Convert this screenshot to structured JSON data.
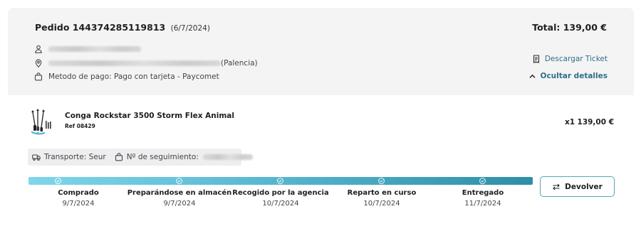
{
  "order": {
    "title": "Pedido 144374285119813",
    "date": "(6/7/2024)",
    "total": "Total: 139,00 €",
    "address_suffix": "(Palencia)",
    "payment_method": "Metodo de pago: Pago con tarjeta - Paycomet",
    "download_ticket": "Descargar Ticket",
    "hide_details": "Ocultar detalles"
  },
  "product": {
    "name": "Conga Rockstar 3500 Storm Flex Animal",
    "ref": "Ref 08429",
    "quantity": "x1",
    "price": "139,00 €"
  },
  "shipping": {
    "transport": "Transporte: Seur",
    "tracking_label": "Nº de seguimiento:"
  },
  "progress": {
    "steps": [
      {
        "label": "Comprado",
        "date": "9/7/2024"
      },
      {
        "label": "Preparándose en almacén",
        "date": "9/7/2024"
      },
      {
        "label": "Recogido por la agencia",
        "date": "10/7/2024"
      },
      {
        "label": "Reparto en curso",
        "date": "10/7/2024"
      },
      {
        "label": "Entregado",
        "date": "11/7/2024"
      }
    ]
  },
  "actions": {
    "return_label": "Devolver"
  },
  "colors": {
    "header_bg": "#f4f4f5",
    "link": "#2e6f86",
    "progress_start": "#7fd6ea",
    "progress_end": "#2e8ea6",
    "button_border": "#5aa3bb"
  },
  "icons": {
    "user": "user-icon",
    "location": "location-pin-icon",
    "payment": "bag-icon",
    "ticket": "receipt-icon",
    "toggle": "chevron-up-icon",
    "transport": "truck-icon",
    "tracking": "package-icon",
    "step": "check-circle-icon",
    "return": "swap-arrows-icon"
  }
}
